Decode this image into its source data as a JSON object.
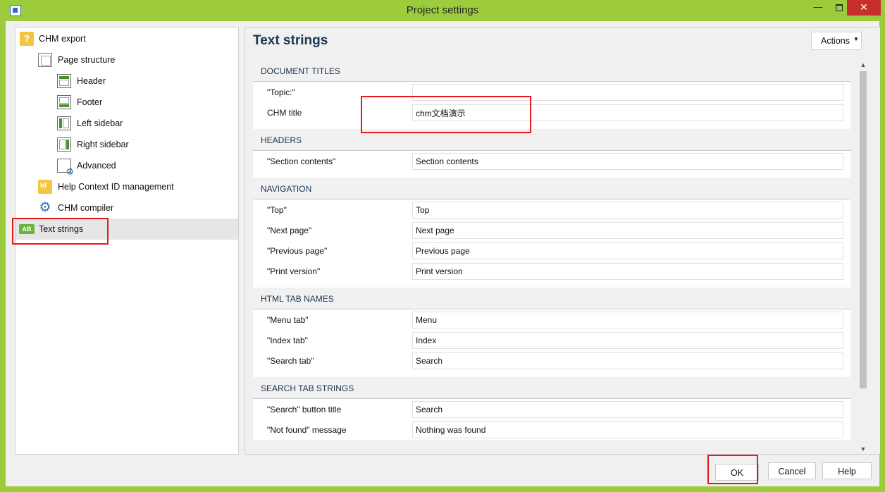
{
  "window": {
    "title": "Project settings"
  },
  "sidebar": {
    "items": [
      {
        "label": "CHM export",
        "icon": "chm-export-icon"
      },
      {
        "label": "Page structure",
        "icon": "page-structure-icon"
      },
      {
        "label": "Header",
        "icon": "header-layout-icon"
      },
      {
        "label": "Footer",
        "icon": "footer-layout-icon"
      },
      {
        "label": "Left sidebar",
        "icon": "left-sidebar-layout-icon"
      },
      {
        "label": "Right sidebar",
        "icon": "right-sidebar-layout-icon"
      },
      {
        "label": "Advanced",
        "icon": "advanced-settings-icon"
      },
      {
        "label": "Help Context ID management",
        "icon": "context-id-icon"
      },
      {
        "label": "CHM compiler",
        "icon": "gears-icon"
      },
      {
        "label": "Text strings",
        "icon": "text-strings-ab-icon",
        "selected": true
      }
    ]
  },
  "main": {
    "title": "Text strings",
    "actions_label": "Actions",
    "sections": [
      {
        "header": "DOCUMENT TITLES",
        "fields": [
          {
            "label": "\"Topic:\"",
            "value": ""
          },
          {
            "label": "CHM title",
            "value": "chm文档演示"
          }
        ]
      },
      {
        "header": "HEADERS",
        "fields": [
          {
            "label": "\"Section contents\"",
            "value": "Section contents"
          }
        ]
      },
      {
        "header": "NAVIGATION",
        "fields": [
          {
            "label": "\"Top\"",
            "value": "Top"
          },
          {
            "label": "\"Next page\"",
            "value": "Next page"
          },
          {
            "label": "\"Previous page\"",
            "value": "Previous page"
          },
          {
            "label": "\"Print version\"",
            "value": "Print version"
          }
        ]
      },
      {
        "header": "HTML TAB NAMES",
        "fields": [
          {
            "label": "\"Menu tab\"",
            "value": "Menu"
          },
          {
            "label": "\"Index tab\"",
            "value": "Index"
          },
          {
            "label": "\"Search tab\"",
            "value": "Search"
          }
        ]
      },
      {
        "header": "SEARCH TAB STRINGS",
        "fields": [
          {
            "label": "\"Search\" button title",
            "value": "Search"
          },
          {
            "label": "\"Not found\" message",
            "value": "Nothing was found"
          }
        ]
      }
    ]
  },
  "footer": {
    "ok_label": "OK",
    "cancel_label": "Cancel",
    "help_label": "Help"
  },
  "colors": {
    "window_frame": "#9ccc3c",
    "close_button": "#c7302a",
    "title_text": "#1d3552",
    "annotation_red": "#e8181d"
  }
}
